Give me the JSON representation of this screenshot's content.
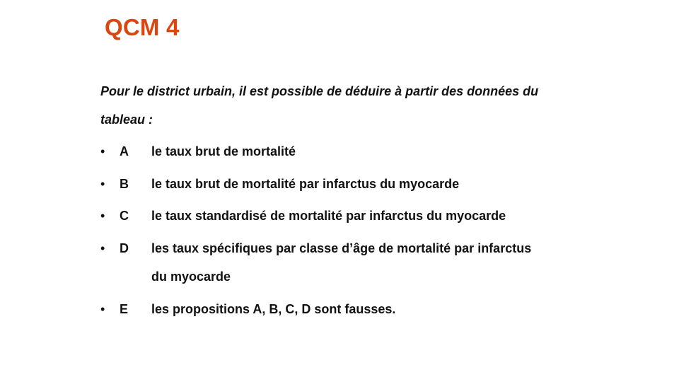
{
  "slide": {
    "title": "QCM 4",
    "title_color": "#d9460f",
    "question": {
      "line1": "Pour le district urbain, il est possible de déduire à partir des données du",
      "line2": "tableau :"
    },
    "bullet_symbol": "•",
    "options": [
      {
        "letter": "A",
        "line1": "le taux brut de mortalité"
      },
      {
        "letter": "B",
        "line1": "le taux brut de mortalité par infarctus du myocarde"
      },
      {
        "letter": "C",
        "line1": "le taux standardisé de mortalité par infarctus du myocarde"
      },
      {
        "letter": "D",
        "line1": "les taux spécifiques par classe d’âge de mortalité par infarctus",
        "line2": "du myocarde"
      },
      {
        "letter": "E",
        "line1": "les propositions A, B, C, D sont fausses."
      }
    ]
  }
}
